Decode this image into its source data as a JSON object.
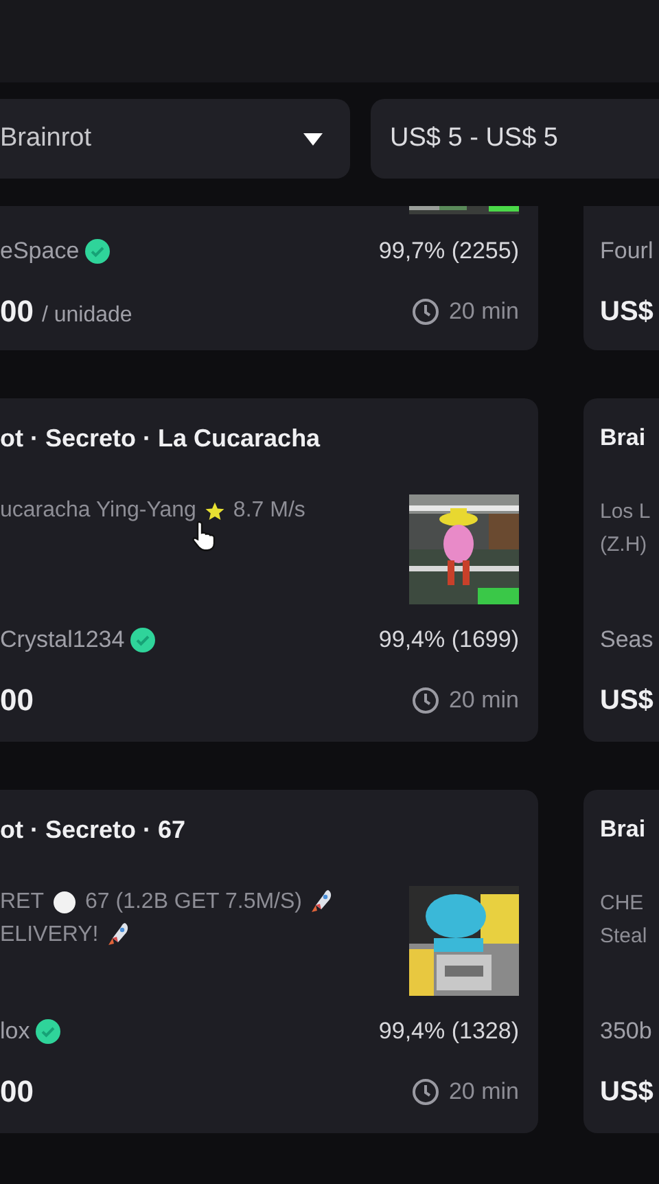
{
  "filters": {
    "category": "Brainrot",
    "price_range": "US$ 5 - US$ 5"
  },
  "rows": [
    {
      "cards": [
        {
          "picture": {
            "kind": "picture"
          },
          "seller": "eSpace",
          "verified": true,
          "rating": "99,7% (2255)",
          "price": "00",
          "unit": "/ unidade",
          "delivery_time": "20 min"
        },
        {
          "seller": "Fourl",
          "price": "US$"
        }
      ]
    },
    {
      "cards": [
        {
          "title": "ot · Secreto · La Cucaracha",
          "description": [
            [
              {
                "kind": "text",
                "text": "ucaracha Ying-Yang"
              },
              {
                "kind": "star"
              },
              {
                "kind": "text",
                "text": "8.7 M/s"
              }
            ]
          ],
          "picture": {
            "kind": "picture"
          },
          "seller": "Crystal1234",
          "verified": true,
          "rating": "99,4% (1699)",
          "price": "00",
          "delivery_time": "20 min"
        },
        {
          "title": "Brai",
          "description": [
            [
              {
                "kind": "text",
                "text": "Los L"
              }
            ],
            [
              {
                "kind": "text",
                "text": "(Z.H)"
              }
            ]
          ],
          "seller": "Seas",
          "price": "US$"
        }
      ]
    },
    {
      "cards": [
        {
          "title": "ot · Secreto · 67",
          "description": [
            [
              {
                "kind": "text",
                "text": "RET"
              },
              {
                "kind": "dot"
              },
              {
                "kind": "text",
                "text": "67 (1.2B GET 7.5M/S)"
              },
              {
                "kind": "rocket"
              }
            ],
            [
              {
                "kind": "text",
                "text": "ELIVERY!"
              },
              {
                "kind": "rocket"
              }
            ]
          ],
          "picture": {
            "kind": "picture"
          },
          "seller": "lox",
          "verified": true,
          "rating": "99,4% (1328)",
          "price": "00",
          "delivery_time": "20 min"
        },
        {
          "title": "Brai",
          "description": [
            [
              {
                "kind": "text",
                "text": "CHE"
              }
            ],
            [
              {
                "kind": "text",
                "text": "Steal"
              }
            ]
          ],
          "seller": "350b",
          "price": "US$"
        }
      ]
    }
  ]
}
